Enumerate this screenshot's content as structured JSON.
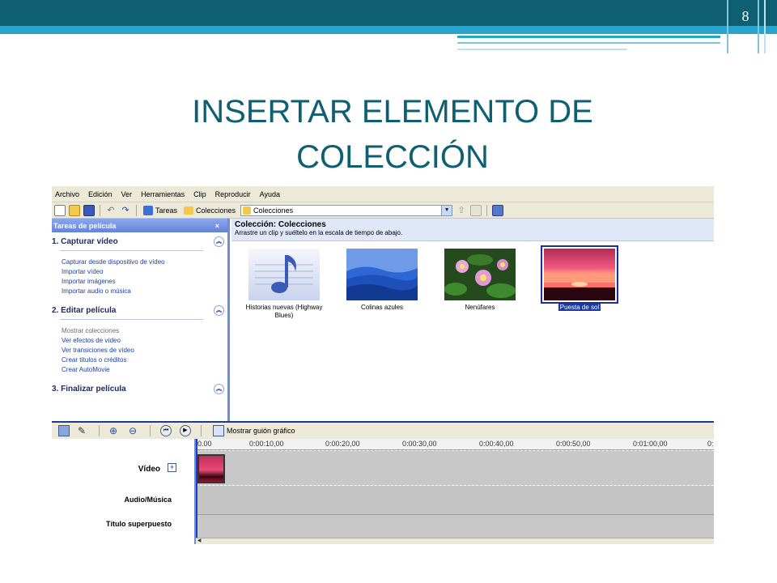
{
  "slide": {
    "page_number": "8",
    "title_line1": "INSERTAR ELEMENTO DE",
    "title_line2": "COLECCIÓN"
  },
  "menu": [
    "Archivo",
    "Edición",
    "Ver",
    "Herramientas",
    "Clip",
    "Reproducir",
    "Ayuda"
  ],
  "toolbar": {
    "tasks_label": "Tareas",
    "collections_label": "Colecciones",
    "combo_value": "Colecciones"
  },
  "taskpane": {
    "header": "Tareas de película",
    "close_glyph": "×",
    "sections": [
      {
        "title": "1. Capturar vídeo",
        "links": [
          "Capturar desde dispositivo de vídeo",
          "Importar vídeo",
          "Importar imágenes",
          "Importar audio o música"
        ]
      },
      {
        "title": "2. Editar película",
        "links": [
          "Mostrar colecciones",
          "Ver efectos de vídeo",
          "Ver transiciones de vídeo",
          "Crear títulos o créditos",
          "Crear AutoMovie"
        ]
      },
      {
        "title": "3. Finalizar película",
        "links": []
      }
    ]
  },
  "collection": {
    "title": "Colección: Colecciones",
    "subtitle": "Arrastre un clip y suéltelo en la escala de tiempo de abajo.",
    "items": [
      {
        "caption_line1": "Historias nuevas (Highway",
        "caption_line2": "Blues)",
        "icon": "music-note-icon"
      },
      {
        "caption_line1": "Colinas azules",
        "caption_line2": "",
        "icon": "blue-hills-image"
      },
      {
        "caption_line1": "Nenúfares",
        "caption_line2": "",
        "icon": "water-lilies-image"
      },
      {
        "caption_line1": "Puesta de sol",
        "caption_line2": "",
        "icon": "sunset-image",
        "selected": true
      }
    ]
  },
  "timeline": {
    "storyboard_label": "Mostrar guión gráfico",
    "ticks": [
      "0.00",
      "0:00:10,00",
      "0:00:20,00",
      "0:00:30,00",
      "0:00:40,00",
      "0:00:50,00",
      "0:01:00,00",
      "0:"
    ],
    "tracks": {
      "video": "Vídeo",
      "expand": "+",
      "audio": "Audio/Música",
      "title": "Título superpuesto"
    }
  },
  "colors": {
    "accent_dark": "#0f5f73",
    "accent_light": "#28a3c9",
    "selection": "#1a3a9e"
  }
}
